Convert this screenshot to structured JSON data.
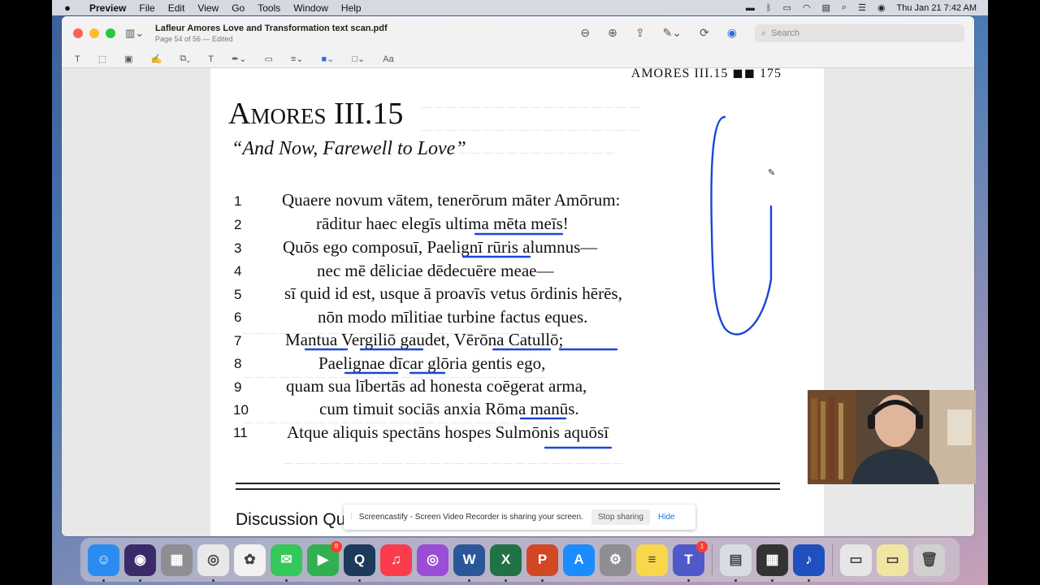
{
  "menubar": {
    "app_name": "Preview",
    "items": [
      "File",
      "Edit",
      "View",
      "Go",
      "Tools",
      "Window",
      "Help"
    ],
    "datetime": "Thu Jan 21  7:42 AM"
  },
  "window": {
    "title": "Lafleur Amores Love and Transformation text scan.pdf",
    "subtitle": "Page 54 of 56 — Edited",
    "search_placeholder": "Search",
    "font_label": "Aa"
  },
  "document": {
    "running_head": "AMORES III.15  ◼◼  175",
    "title": "Amores III.15",
    "subtitle": "“And Now, Farewell to Love”",
    "lines": [
      {
        "num": "1",
        "text": "Quaere novum vātem, tenerōrum māter Amōrum:"
      },
      {
        "num": "2",
        "text": "rāditur haec elegīs ultima mēta meīs!"
      },
      {
        "num": "3",
        "text": "Quōs ego composuī, Paelignī rūris alumnus—"
      },
      {
        "num": "4",
        "text": "nec mē dēliciae dēdecuēre meae—"
      },
      {
        "num": "5",
        "text": "sī quid id est, usque ā proavīs vetus ōrdinis hērēs,"
      },
      {
        "num": "6",
        "text": "nōn modo mīlitiae turbine factus eques."
      },
      {
        "num": "7",
        "text": "Mantua Vergiliō gaudet, Vērōna Catullō;"
      },
      {
        "num": "8",
        "text": "Paelignae dīcar glōria gentis ego,"
      },
      {
        "num": "9",
        "text": "quam sua lībertās ad honesta coēgerat arma,"
      },
      {
        "num": "10",
        "text": "cum timuit sociās anxia Rōma manūs."
      },
      {
        "num": "11",
        "text": "Atque aliquis spectāns hospes Sulmōnis aquōsī"
      }
    ],
    "discussion_heading": "Discussion Questions"
  },
  "screenshare": {
    "message": "Screencastify - Screen Video Recorder is sharing your screen.",
    "stop_label": "Stop sharing",
    "hide_label": "Hide"
  },
  "dock": {
    "apps": [
      {
        "name": "finder",
        "color": "#2a8cf0",
        "glyph": "☺"
      },
      {
        "name": "siri",
        "color": "#3a2a6a",
        "glyph": "◉"
      },
      {
        "name": "launchpad",
        "color": "#8e8e93",
        "glyph": "▦"
      },
      {
        "name": "chrome",
        "color": "#e8e8e8",
        "glyph": "◎"
      },
      {
        "name": "photos",
        "color": "#f2f2f2",
        "glyph": "✿"
      },
      {
        "name": "messages",
        "color": "#34c759",
        "glyph": "✉"
      },
      {
        "name": "facetime",
        "color": "#30b050",
        "glyph": "▶",
        "badge": "8"
      },
      {
        "name": "quicktime",
        "color": "#1c3a5a",
        "glyph": "Q"
      },
      {
        "name": "music",
        "color": "#fa3c4c",
        "glyph": "♫"
      },
      {
        "name": "podcasts",
        "color": "#9b4dd6",
        "glyph": "◎"
      },
      {
        "name": "word",
        "color": "#2b579a",
        "glyph": "W"
      },
      {
        "name": "excel",
        "color": "#217346",
        "glyph": "X"
      },
      {
        "name": "powerpoint",
        "color": "#d24726",
        "glyph": "P"
      },
      {
        "name": "app-store",
        "color": "#1a8cff",
        "glyph": "A"
      },
      {
        "name": "system-preferences",
        "color": "#8e8e93",
        "glyph": "⚙"
      },
      {
        "name": "stickies",
        "color": "#f7d84a",
        "glyph": "≡"
      },
      {
        "name": "teams",
        "color": "#5059c9",
        "glyph": "T",
        "badge": "1"
      },
      {
        "name": "preview",
        "color": "#d8dde5",
        "glyph": "▤"
      },
      {
        "name": "calculator",
        "color": "#333333",
        "glyph": "▦"
      },
      {
        "name": "audacity",
        "color": "#2050c0",
        "glyph": "♪"
      },
      {
        "name": "downloads-stack",
        "color": "#e6e6e6",
        "glyph": "▭"
      },
      {
        "name": "documents-stack",
        "color": "#f1e6a0",
        "glyph": "▭"
      },
      {
        "name": "trash",
        "color": "#d0d0d0",
        "glyph": "🗑"
      }
    ]
  },
  "colors": {
    "ink": "#1a46d8",
    "accent": "#2f6fdc"
  }
}
